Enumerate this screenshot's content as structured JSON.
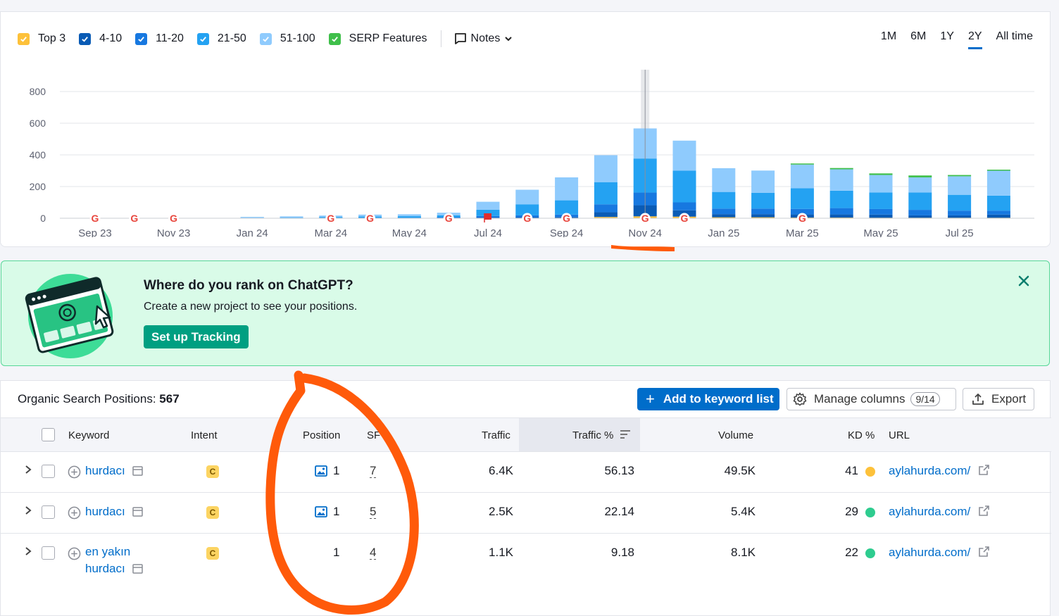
{
  "legend": {
    "items": [
      {
        "label": "Top 3",
        "color": "#fdc13a"
      },
      {
        "label": "4-10",
        "color": "#0a5bb5"
      },
      {
        "label": "11-20",
        "color": "#1778e0"
      },
      {
        "label": "21-50",
        "color": "#24a2f2"
      },
      {
        "label": "51-100",
        "color": "#8fcbfd"
      },
      {
        "label": "SERP Features",
        "color": "#3fbf4a"
      }
    ],
    "notes_label": "Notes"
  },
  "ranges": {
    "items": [
      "1M",
      "6M",
      "1Y",
      "2Y",
      "All time"
    ],
    "active": "2Y"
  },
  "chart_data": {
    "type": "bar",
    "stacked": true,
    "ylim": [
      0,
      800
    ],
    "yticks": [
      0,
      200,
      400,
      600,
      800
    ],
    "grid": true,
    "xtick_labels": [
      "Sep 23",
      "Nov 23",
      "Jan 24",
      "Mar 24",
      "May 24",
      "Jul 24",
      "Sep 24",
      "Nov 24",
      "Jan 25",
      "Mar 25",
      "May 25",
      "Jul 25"
    ],
    "categories": [
      "Sep 23",
      "Oct 23",
      "Nov 23",
      "Dec 23",
      "Jan 24",
      "Feb 24",
      "Mar 24",
      "Apr 24",
      "May 24",
      "Jun 24",
      "Jul 24",
      "Aug 24",
      "Sep 24",
      "Oct 24",
      "Nov 24",
      "Dec 24",
      "Jan 25",
      "Feb 25",
      "Mar 25",
      "Apr 25",
      "May 25",
      "Jun 25",
      "Jul 25",
      "Aug 25"
    ],
    "series": [
      {
        "name": "Top 3",
        "color": "#fdc13a",
        "values": [
          0,
          0,
          0,
          0,
          0,
          0,
          0,
          0,
          0,
          0,
          0,
          0,
          0,
          8,
          12,
          10,
          6,
          6,
          4,
          4,
          3,
          3,
          3,
          3
        ]
      },
      {
        "name": "4-10",
        "color": "#0a5bb5",
        "values": [
          0,
          0,
          0,
          0,
          0,
          0,
          0,
          0,
          0,
          2,
          4,
          6,
          8,
          30,
          70,
          40,
          20,
          20,
          20,
          20,
          20,
          15,
          15,
          20
        ]
      },
      {
        "name": "11-20",
        "color": "#1778e0",
        "values": [
          0,
          0,
          0,
          0,
          0,
          0,
          2,
          3,
          3,
          5,
          10,
          12,
          15,
          50,
          80,
          50,
          35,
          35,
          35,
          40,
          35,
          35,
          30,
          25
        ]
      },
      {
        "name": "21-50",
        "color": "#24a2f2",
        "values": [
          0,
          0,
          0,
          0,
          2,
          4,
          6,
          8,
          10,
          12,
          40,
          70,
          90,
          140,
          215,
          200,
          105,
          100,
          130,
          110,
          105,
          110,
          100,
          95
        ]
      },
      {
        "name": "51-100",
        "color": "#8fcbfd",
        "values": [
          0,
          0,
          0,
          0,
          3,
          8,
          9,
          12,
          12,
          16,
          50,
          92,
          145,
          170,
          190,
          190,
          150,
          140,
          150,
          135,
          110,
          95,
          117,
          157
        ]
      },
      {
        "name": "SERP Features",
        "color": "#3fbf4a",
        "values": [
          0,
          0,
          0,
          0,
          0,
          0,
          0,
          0,
          0,
          0,
          0,
          0,
          0,
          0,
          0,
          0,
          0,
          0,
          6,
          8,
          10,
          12,
          8,
          6
        ]
      }
    ],
    "google_markers": [
      "Sep 23",
      "Oct 23",
      "Nov 23",
      "Mar 24",
      "Apr 24",
      "Jun 24",
      "Aug 24",
      "Sep 24",
      "Nov 24",
      "Dec 24",
      "Mar 25"
    ],
    "flag_markers": [
      "Jul 24"
    ],
    "highlight_category": "Nov 24"
  },
  "banner": {
    "title": "Where do you rank on ChatGPT?",
    "text": "Create a new project to see your positions.",
    "button": "Set up Tracking"
  },
  "table": {
    "title_label": "Organic Search Positions:",
    "title_count": "567",
    "add_button": "Add to keyword list",
    "manage_button": "Manage columns",
    "manage_count": "9/14",
    "export_button": "Export",
    "headers": {
      "keyword": "Keyword",
      "intent": "Intent",
      "position": "Position",
      "sf": "SF",
      "traffic": "Traffic",
      "traffic_pct": "Traffic %",
      "volume": "Volume",
      "kd": "KD %",
      "url": "URL"
    },
    "rows": [
      {
        "keyword": "hurdacı",
        "intent": "C",
        "position": "1",
        "sf": "7",
        "traffic": "6.4K",
        "traffic_pct": "56.13",
        "volume": "49.5K",
        "kd": "41",
        "kd_color": "#fdc13a",
        "url": "aylahurda.com/"
      },
      {
        "keyword": "hurdacı",
        "intent": "C",
        "position": "1",
        "sf": "5",
        "traffic": "2.5K",
        "traffic_pct": "22.14",
        "volume": "5.4K",
        "kd": "29",
        "kd_color": "#2ecc8f",
        "url": "aylahurda.com/"
      },
      {
        "keyword_line1": "en yakın",
        "keyword_line2": "hurdacı",
        "intent": "C",
        "position": "1",
        "sf": "4",
        "traffic": "1.1K",
        "traffic_pct": "9.18",
        "volume": "8.1K",
        "kd": "22",
        "kd_color": "#2ecc8f",
        "url": "aylahurda.com/"
      }
    ]
  }
}
